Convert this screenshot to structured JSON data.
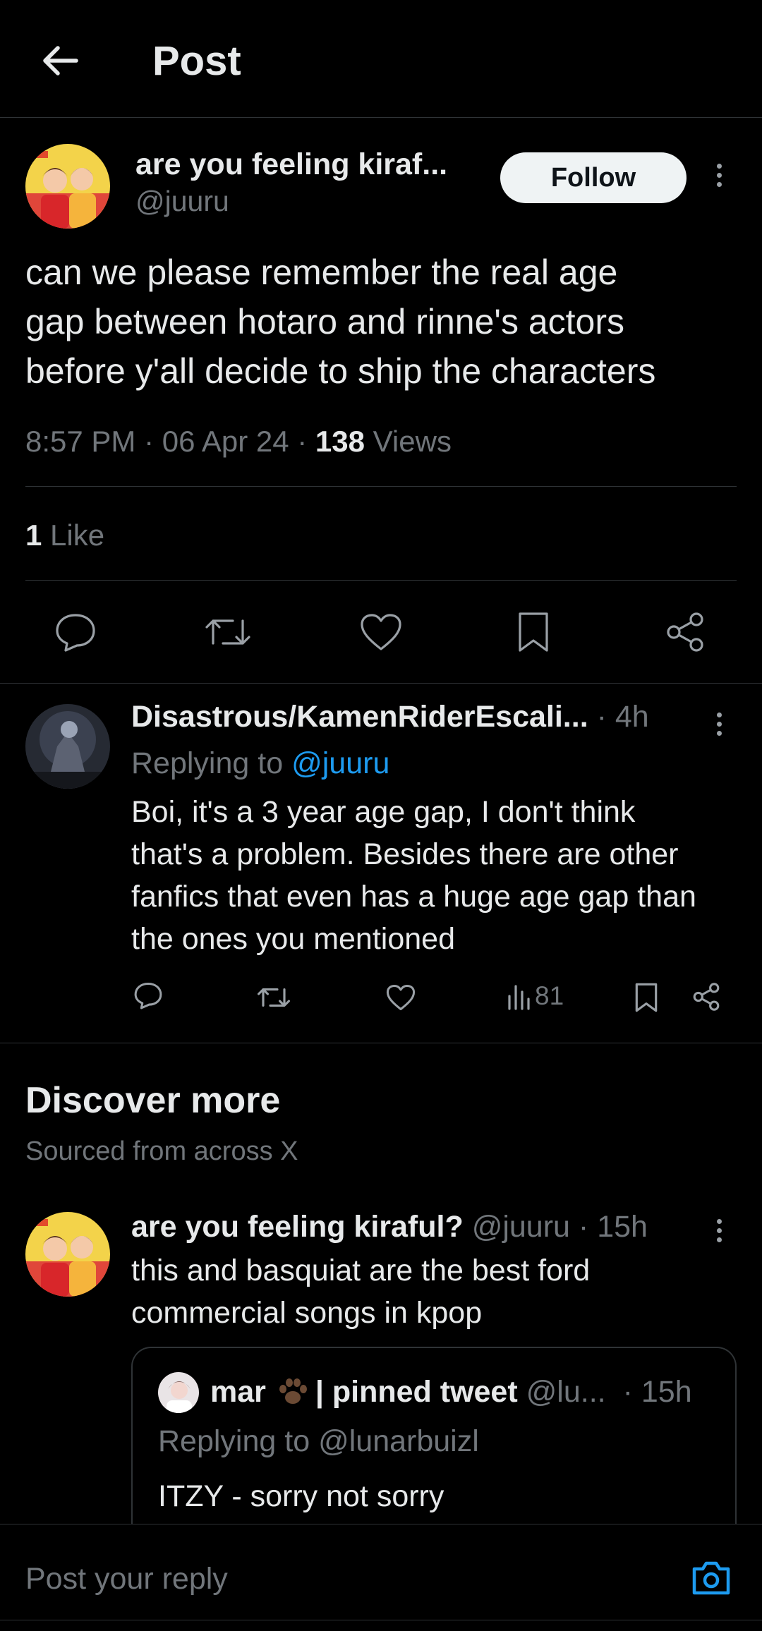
{
  "header": {
    "title": "Post"
  },
  "main_post": {
    "display_name": "are you feeling kiraf...",
    "handle": "@juuru",
    "follow_label": "Follow",
    "text_lines": [
      "can we please remember the real age",
      "gap between hotaro and rinne's actors",
      "before y'all decide to ship the characters"
    ],
    "time": "8:57 PM",
    "date": "06 Apr 24",
    "sep": "·",
    "views_count": "138",
    "views_label": "Views",
    "likes_count": "1",
    "likes_label": "Like"
  },
  "reply": {
    "display_name": "Disastrous/KamenRiderEscali...",
    "time": "· 4h",
    "replying_prefix": "Replying to",
    "replying_handle": "@juuru",
    "text_lines": [
      "Boi, it's a 3 year age gap, I don't think",
      "that's a problem. Besides there are other",
      "fanfics that even has a huge age gap than",
      "the ones you mentioned"
    ],
    "views": "81"
  },
  "discover": {
    "title": "Discover more",
    "subtitle": "Sourced from across X"
  },
  "discover_post": {
    "display_name": "are you feeling kiraful?",
    "handle": "@juuru",
    "time": "· 15h",
    "text_lines": [
      "this and basquiat are the best ford",
      "commercial songs in kpop"
    ],
    "quote": {
      "display_name_a": "mar",
      "display_name_b": "| pinned tweet",
      "handle": "@lu...",
      "time": "· 15h",
      "replying": "Replying to @lunarbuizl",
      "text": "ITZY - sorry not sorry"
    }
  },
  "composer": {
    "placeholder": "Post your reply"
  },
  "colors": {
    "background": "#000000",
    "accent": "#1d9bf0",
    "muted": "#71767b",
    "text": "#e7e9ea"
  }
}
